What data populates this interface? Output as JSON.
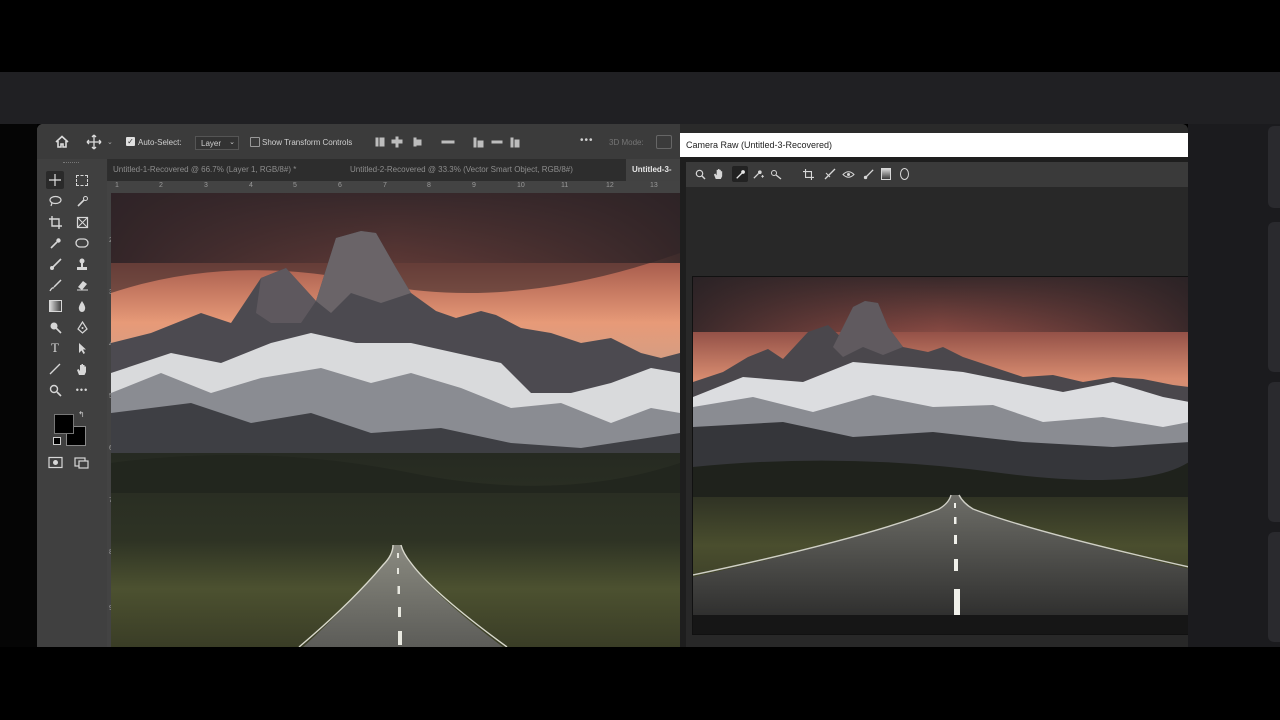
{
  "options_bar": {
    "auto_select_label": "Auto-Select:",
    "auto_select_checked": true,
    "layer_select_value": "Layer",
    "show_transform_label": "Show Transform Controls",
    "more_label": "•••",
    "mode_3d_label": "3D Mode:"
  },
  "document_tabs": [
    {
      "label": "Untitled-1-Recovered @ 66.7% (Layer 1, RGB/8#) *"
    },
    {
      "label": "Untitled-2-Recovered @ 33.3% (Vector Smart Object, RGB/8#)"
    },
    {
      "label": "Untitled-3-"
    }
  ],
  "ruler_top": [
    "1",
    "2",
    "3",
    "4",
    "5",
    "6",
    "7",
    "8",
    "9",
    "10",
    "11",
    "12",
    "13"
  ],
  "ruler_left": [
    "2",
    "3",
    "4",
    "5",
    "6",
    "7",
    "8",
    "9"
  ],
  "camera_raw": {
    "title": "Camera Raw (Untitled-3-Recovered)"
  },
  "colors": {
    "ps_panel": "#535353",
    "toolbar": "#404040",
    "options_bar": "#3b3b3b",
    "camera_raw_bg": "#1e1e1e"
  },
  "icons": {
    "home": "home-icon",
    "move": "move-icon",
    "zoom": "zoom-icon",
    "hand": "hand-icon",
    "eyedropper": "eyedropper-icon"
  }
}
